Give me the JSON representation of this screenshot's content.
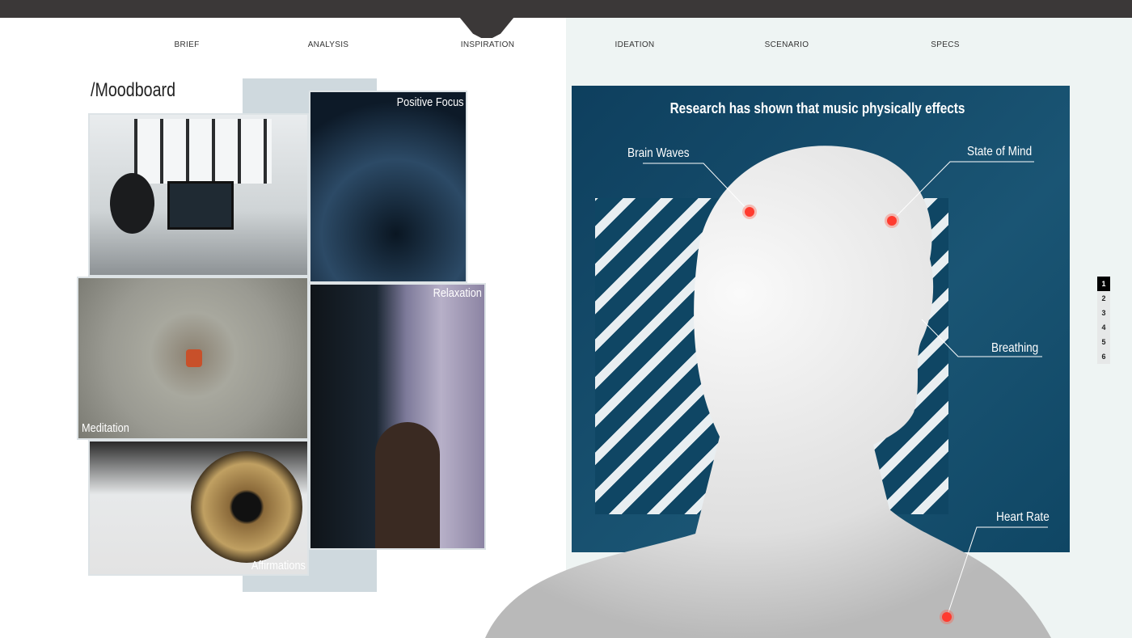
{
  "nav": {
    "items": [
      {
        "label": "BRIEF"
      },
      {
        "label": "ANALYSIS"
      },
      {
        "label": "INSPIRATION",
        "active": true
      },
      {
        "label": "IDEATION"
      },
      {
        "label": "SCENARIO"
      },
      {
        "label": "SPECS"
      }
    ]
  },
  "moodboard": {
    "title": "/Moodboard",
    "tiles": [
      {
        "label": "Positive Focus"
      },
      {
        "label": "Relaxation"
      },
      {
        "label": "Meditation"
      },
      {
        "label": "Affirmations"
      }
    ]
  },
  "research": {
    "headline": "Research has shown that music physically effects",
    "callouts": [
      {
        "label": "Brain Waves"
      },
      {
        "label": "State of Mind"
      },
      {
        "label": "Breathing"
      },
      {
        "label": "Heart Rate"
      }
    ]
  },
  "pager": {
    "pages": [
      "1",
      "2",
      "3",
      "4",
      "5",
      "6"
    ],
    "active": "1"
  },
  "colors": {
    "topbar": "#3b3838",
    "panel": "#0f4664",
    "dot": "#ff3b2f"
  }
}
